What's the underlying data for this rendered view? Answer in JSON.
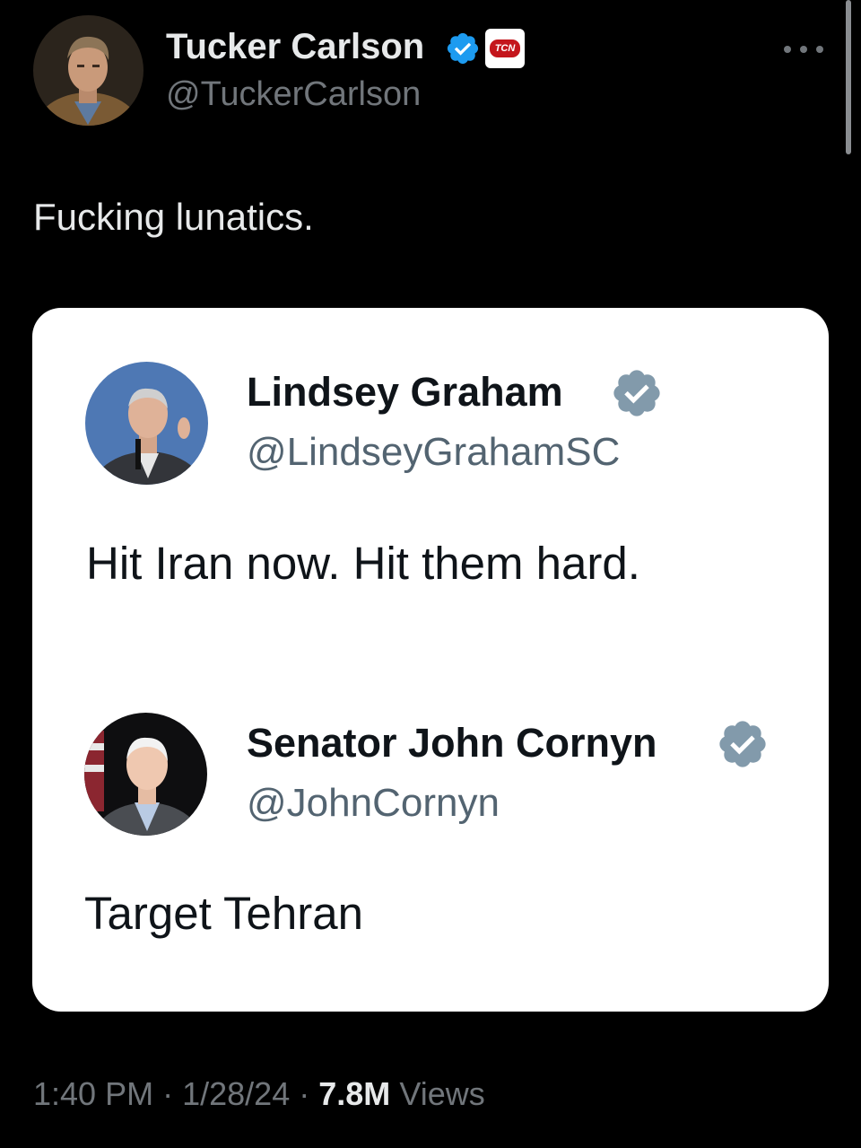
{
  "author": {
    "name": "Tucker Carlson",
    "handle": "@TuckerCarlson",
    "affiliate_badge": "TCN"
  },
  "tweet": {
    "text": "Fucking lunatics."
  },
  "embedded_image": {
    "quotes": [
      {
        "name": "Lindsey Graham",
        "handle": "@LindseyGrahamSC",
        "text": "Hit Iran now. Hit them hard."
      },
      {
        "name": "Senator John Cornyn",
        "handle": "@JohnCornyn",
        "text": "Target Tehran"
      }
    ]
  },
  "meta": {
    "time": "1:40 PM",
    "date": "1/28/24",
    "views_count": "7.8M",
    "views_label": "Views",
    "separator": "·"
  },
  "colors": {
    "background": "#000000",
    "verified_blue": "#1d9bf0",
    "verified_gray": "#829aab",
    "secondary_text": "#71767b"
  }
}
